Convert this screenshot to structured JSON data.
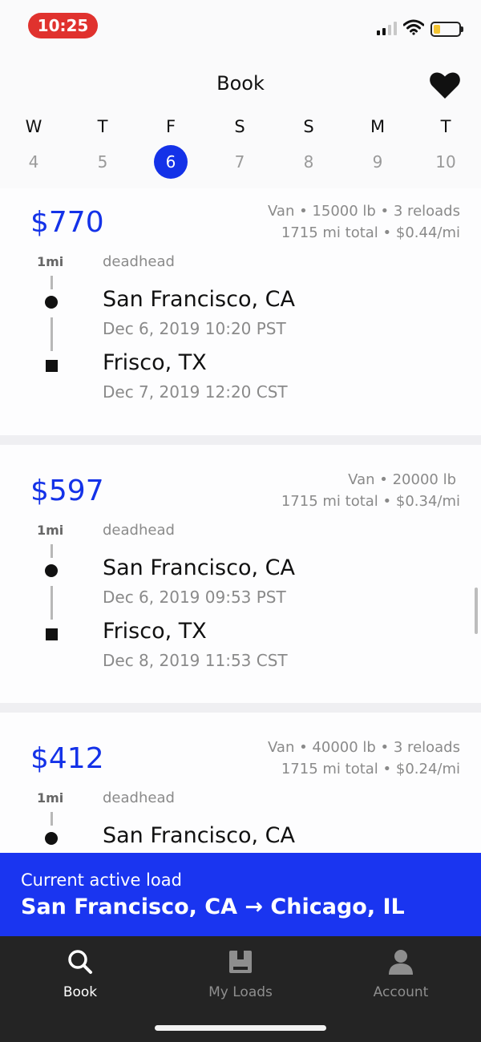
{
  "status_bar": {
    "time": "10:25",
    "time_pill_color": "#e0322e",
    "battery_color": "#f3c433"
  },
  "header": {
    "title": "Book",
    "favorite_icon": "heart-icon"
  },
  "date_strip": {
    "days": [
      {
        "letter": "W",
        "number": "4",
        "selected": false
      },
      {
        "letter": "T",
        "number": "5",
        "selected": false
      },
      {
        "letter": "F",
        "number": "6",
        "selected": true
      },
      {
        "letter": "S",
        "number": "7",
        "selected": false
      },
      {
        "letter": "S",
        "number": "8",
        "selected": false
      },
      {
        "letter": "M",
        "number": "9",
        "selected": false
      },
      {
        "letter": "T",
        "number": "10",
        "selected": false
      }
    ]
  },
  "loads": [
    {
      "price": "$770",
      "meta_line1": "Van • 15000 lb • 3 reloads",
      "meta_line2": "1715 mi total • $0.44/mi",
      "deadhead_distance": "1mi",
      "deadhead_label": "deadhead",
      "origin_city": "San Francisco, CA",
      "origin_datetime": "Dec 6, 2019 10:20 PST",
      "destination_city": "Frisco, TX",
      "destination_datetime": "Dec 7, 2019 12:20 CST"
    },
    {
      "price": "$597",
      "meta_line1": "Van • 20000 lb",
      "meta_line2": "1715 mi total • $0.34/mi",
      "deadhead_distance": "1mi",
      "deadhead_label": "deadhead",
      "origin_city": "San Francisco, CA",
      "origin_datetime": "Dec 6, 2019 09:53 PST",
      "destination_city": "Frisco, TX",
      "destination_datetime": "Dec 8, 2019 11:53 CST"
    },
    {
      "price": "$412",
      "meta_line1": "Van • 40000 lb • 3 reloads",
      "meta_line2": "1715 mi total • $0.24/mi",
      "deadhead_distance": "1mi",
      "deadhead_label": "deadhead",
      "origin_city": "San Francisco, CA"
    }
  ],
  "active_load": {
    "label": "Current active load",
    "route": "San Francisco, CA → Chicago, IL",
    "color": "#1a35f0"
  },
  "tabs": [
    {
      "label": "Book",
      "icon": "search-icon",
      "active": true
    },
    {
      "label": "My Loads",
      "icon": "package-icon",
      "active": false
    },
    {
      "label": "Account",
      "icon": "person-icon",
      "active": false
    }
  ],
  "colors": {
    "accent": "#1432e8",
    "tab_bar": "#242424"
  }
}
